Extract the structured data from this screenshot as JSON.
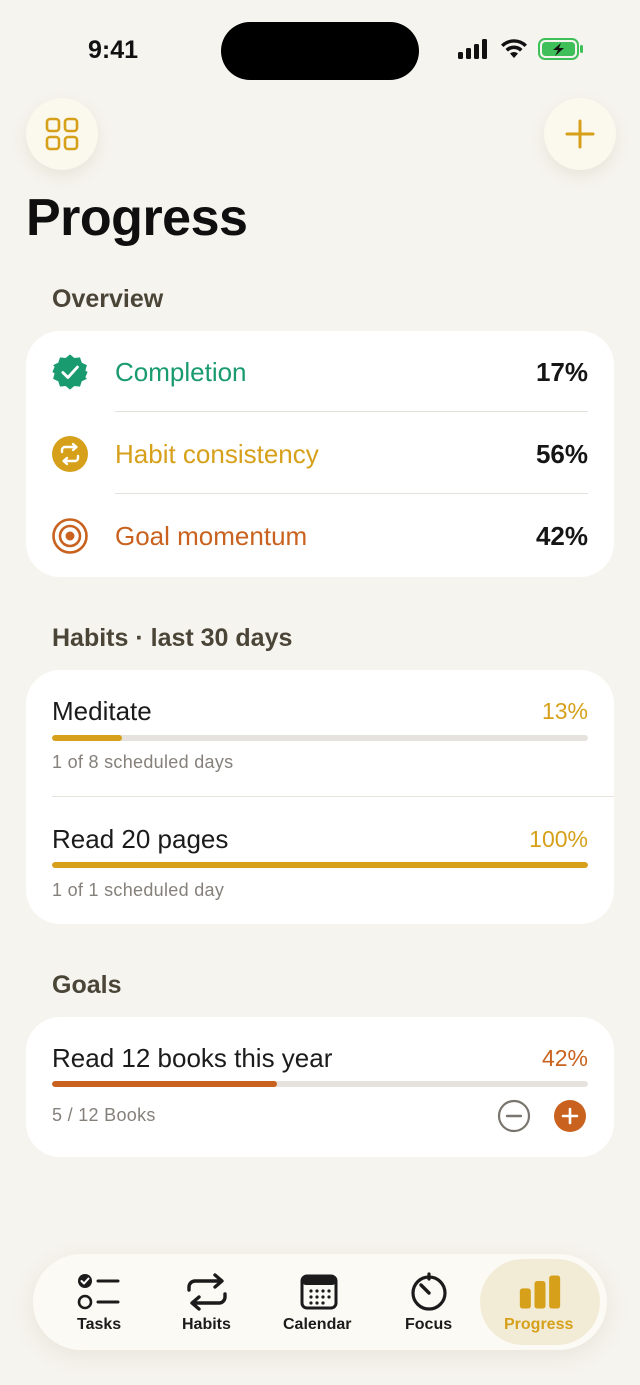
{
  "status_bar": {
    "time": "9:41"
  },
  "header": {
    "title": "Progress"
  },
  "overview": {
    "section_label": "Overview",
    "rows": [
      {
        "label": "Completion",
        "value": "17%",
        "color": "#1a9b6f",
        "icon": "verified-check-icon"
      },
      {
        "label": "Habit consistency",
        "value": "56%",
        "color": "#d6a01a",
        "icon": "repeat-circle-icon"
      },
      {
        "label": "Goal momentum",
        "value": "42%",
        "color": "#c8621e",
        "icon": "target-icon"
      }
    ]
  },
  "habits": {
    "section_label": "Habits · last 30 days",
    "items": [
      {
        "name": "Meditate",
        "percent_text": "13%",
        "progress": 0.13,
        "sub": "1 of 8 scheduled days"
      },
      {
        "name": "Read 20 pages",
        "percent_text": "100%",
        "progress": 1.0,
        "sub": "1 of 1 scheduled day"
      }
    ],
    "accent": "#d6a01a"
  },
  "goals": {
    "section_label": "Goals",
    "items": [
      {
        "name": "Read 12 books this year",
        "percent_text": "42%",
        "progress": 0.42,
        "sub": "5 / 12 Books"
      }
    ],
    "accent": "#c8621e"
  },
  "tabbar": {
    "tabs": [
      {
        "label": "Tasks",
        "icon": "tasks-checklist-icon"
      },
      {
        "label": "Habits",
        "icon": "repeat-arrows-icon"
      },
      {
        "label": "Calendar",
        "icon": "calendar-icon"
      },
      {
        "label": "Focus",
        "icon": "timer-icon"
      },
      {
        "label": "Progress",
        "icon": "bar-chart-icon",
        "active": true
      }
    ]
  },
  "colors": {
    "background": "#f6f4ef",
    "accent": "#d6a01a",
    "green": "#1a9b6f",
    "orange": "#c8621e"
  }
}
